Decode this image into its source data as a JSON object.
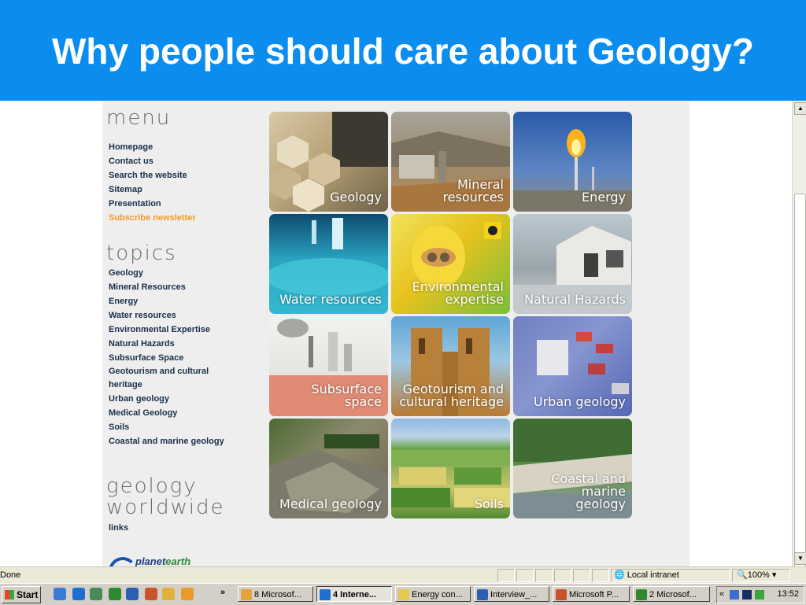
{
  "slide": {
    "title": "Why people should care about Geology?"
  },
  "sidebar": {
    "menu_heading": "menu",
    "menu_items": [
      "Homepage",
      "Contact us",
      "Search the website",
      "Sitemap",
      "Presentation",
      "Subscribe newsletter"
    ],
    "topics_heading": "topics",
    "topic_items": [
      "Geology",
      "Mineral Resources",
      "Energy",
      "Water resources",
      "Environmental Expertise",
      "Natural Hazards",
      "Subsurface Space",
      "Geotourism and cultural",
      "heritage",
      "Urban geology",
      "Medical Geology",
      "Soils",
      "Coastal and marine geology"
    ],
    "worldwide_heading_1": "geology",
    "worldwide_heading_2": "worldwide",
    "worldwide_items": [
      "links"
    ],
    "logo_text_a": "planet",
    "logo_text_b": "earth"
  },
  "tiles": [
    {
      "line1": "Geology",
      "line2": ""
    },
    {
      "line1": "Mineral",
      "line2": "resources"
    },
    {
      "line1": "Energy",
      "line2": ""
    },
    {
      "line1": "Water resources",
      "line2": ""
    },
    {
      "line1": "Environmental",
      "line2": "expertise"
    },
    {
      "line1": "Natural Hazards",
      "line2": ""
    },
    {
      "line1": "Subsurface space",
      "line2": ""
    },
    {
      "line1": "Geotourism and",
      "line2": "cultural heritage"
    },
    {
      "line1": "Urban geology",
      "line2": ""
    },
    {
      "line1": "Medical geology",
      "line2": ""
    },
    {
      "line1": "Soils",
      "line2": ""
    },
    {
      "line1": "Coastal and marine",
      "line2": "geology"
    }
  ],
  "statusbar": {
    "status": "Done",
    "zone": "Local intranet",
    "zoom": "100%"
  },
  "taskbar": {
    "start_label": "Start",
    "overflow": "»",
    "tasks": [
      "8 Microsof...",
      "4 Interne...",
      "Energy con...",
      "Interview_...",
      "Microsoft P...",
      "2 Microsof..."
    ],
    "tray_prefix": "«",
    "clock": "13:52"
  },
  "colors": {
    "title_band": "#0b8df0",
    "link_text": "#1a2f4a",
    "link_highlight": "#f59a23",
    "page_bg": "#eeeeee"
  }
}
